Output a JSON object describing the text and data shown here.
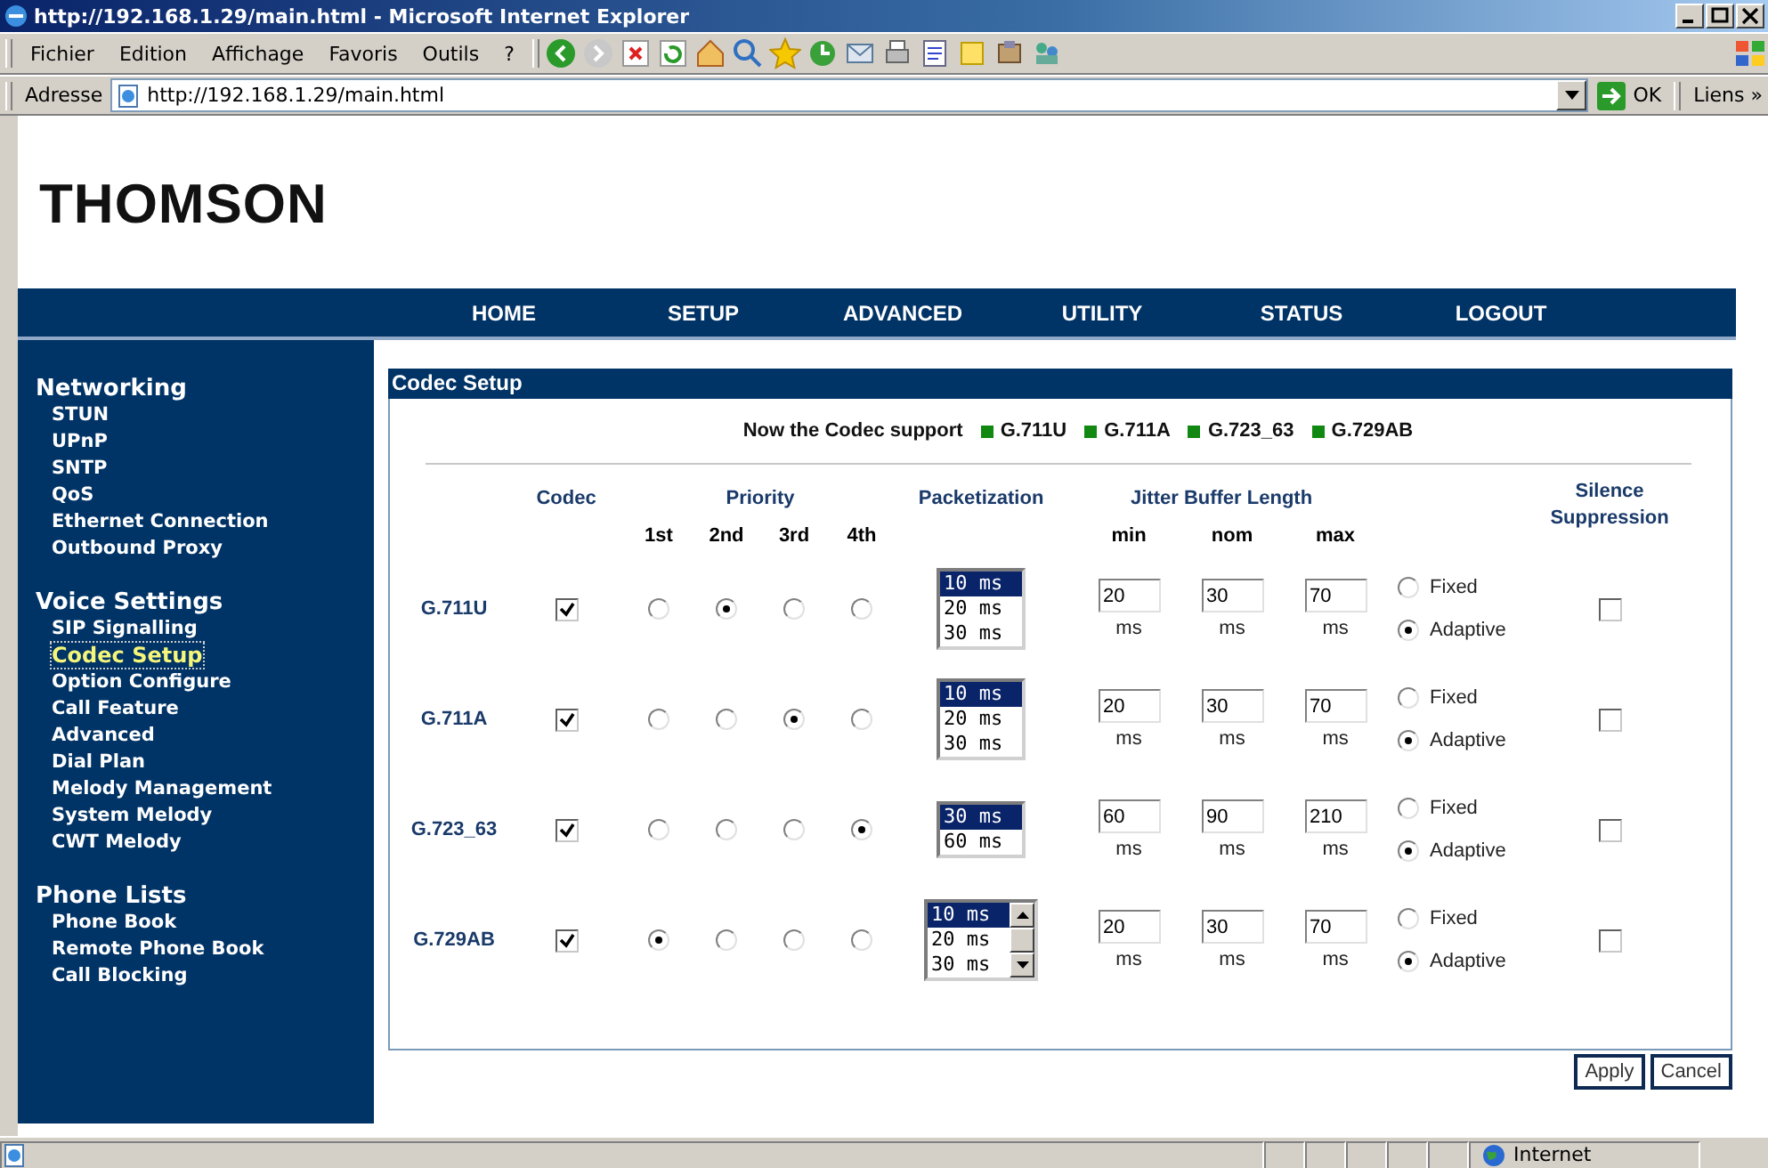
{
  "window": {
    "title": "http://192.168.1.29/main.html - Microsoft Internet Explorer"
  },
  "menu": [
    "Fichier",
    "Edition",
    "Affichage",
    "Favoris",
    "Outils",
    "?"
  ],
  "address_bar": {
    "label": "Adresse",
    "value": "http://192.168.1.29/main.html",
    "go": "OK",
    "links": "Liens",
    "more": "»"
  },
  "logo": "THOMSON",
  "nav": [
    "HOME",
    "SETUP",
    "ADVANCED",
    "UTILITY",
    "STATUS",
    "LOGOUT"
  ],
  "sidebar": [
    {
      "heading": "Networking",
      "items": [
        {
          "label": "STUN",
          "selected": false
        },
        {
          "label": "UPnP",
          "selected": false
        },
        {
          "label": "SNTP",
          "selected": false
        },
        {
          "label": "QoS",
          "selected": false
        },
        {
          "label": "Ethernet Connection",
          "selected": false
        },
        {
          "label": "Outbound Proxy",
          "selected": false
        }
      ]
    },
    {
      "heading": "Voice Settings",
      "items": [
        {
          "label": "SIP Signalling",
          "selected": false
        },
        {
          "label": "Codec Setup",
          "selected": true
        },
        {
          "label": "Option Configure",
          "selected": false
        },
        {
          "label": "Call Feature",
          "selected": false
        },
        {
          "label": "Advanced",
          "selected": false
        },
        {
          "label": "Dial Plan",
          "selected": false
        },
        {
          "label": "Melody Management",
          "selected": false
        },
        {
          "label": "System Melody",
          "selected": false
        },
        {
          "label": "CWT Melody",
          "selected": false
        }
      ]
    },
    {
      "heading": "Phone Lists",
      "items": [
        {
          "label": "Phone Book",
          "selected": false
        },
        {
          "label": "Remote Phone Book",
          "selected": false
        },
        {
          "label": "Call Blocking",
          "selected": false
        }
      ]
    }
  ],
  "panel": {
    "title": "Codec Setup",
    "support_label": "Now the Codec support",
    "supported": [
      {
        "label": "G.711U",
        "color": "#118811"
      },
      {
        "label": "G.711A",
        "color": "#118811"
      },
      {
        "label": "G.723_63",
        "color": "#118811"
      },
      {
        "label": "G.729AB",
        "color": "#118811"
      }
    ],
    "headers": {
      "codec": "Codec",
      "priority": "Priority",
      "priorities": [
        "1st",
        "2nd",
        "3rd",
        "4th"
      ],
      "packetization": "Packetization",
      "jitter": "Jitter Buffer Length",
      "jitter_cols": [
        "min",
        "nom",
        "max"
      ],
      "silence": "Silence Suppression"
    },
    "rows": [
      {
        "name": "G.711U",
        "enabled": true,
        "priority": [
          {
            "selected": false
          },
          {
            "selected": true
          },
          {
            "selected": false
          },
          {
            "selected": false
          }
        ],
        "packetization": {
          "scrollable": false,
          "options": [
            {
              "label": "10 ms",
              "selected": true
            },
            {
              "label": "20 ms",
              "selected": false
            },
            {
              "label": "30 ms",
              "selected": false
            }
          ]
        },
        "jitter": [
          {
            "value": "20",
            "unit": "ms"
          },
          {
            "value": "30",
            "unit": "ms"
          },
          {
            "value": "70",
            "unit": "ms"
          }
        ],
        "modes": [
          {
            "label": "Fixed",
            "selected": false
          },
          {
            "label": "Adaptive",
            "selected": true
          }
        ],
        "silence_suppression": false
      },
      {
        "name": "G.711A",
        "enabled": true,
        "priority": [
          {
            "selected": false
          },
          {
            "selected": false
          },
          {
            "selected": true
          },
          {
            "selected": false
          }
        ],
        "packetization": {
          "scrollable": false,
          "options": [
            {
              "label": "10 ms",
              "selected": true
            },
            {
              "label": "20 ms",
              "selected": false
            },
            {
              "label": "30 ms",
              "selected": false
            }
          ]
        },
        "jitter": [
          {
            "value": "20",
            "unit": "ms"
          },
          {
            "value": "30",
            "unit": "ms"
          },
          {
            "value": "70",
            "unit": "ms"
          }
        ],
        "modes": [
          {
            "label": "Fixed",
            "selected": false
          },
          {
            "label": "Adaptive",
            "selected": true
          }
        ],
        "silence_suppression": false
      },
      {
        "name": "G.723_63",
        "enabled": true,
        "priority": [
          {
            "selected": false
          },
          {
            "selected": false
          },
          {
            "selected": false
          },
          {
            "selected": true
          }
        ],
        "packetization": {
          "scrollable": false,
          "options": [
            {
              "label": "30 ms",
              "selected": true
            },
            {
              "label": "60 ms",
              "selected": false
            }
          ]
        },
        "jitter": [
          {
            "value": "60",
            "unit": "ms"
          },
          {
            "value": "90",
            "unit": "ms"
          },
          {
            "value": "210",
            "unit": "ms"
          }
        ],
        "modes": [
          {
            "label": "Fixed",
            "selected": false
          },
          {
            "label": "Adaptive",
            "selected": true
          }
        ],
        "silence_suppression": false
      },
      {
        "name": "G.729AB",
        "enabled": true,
        "priority": [
          {
            "selected": true
          },
          {
            "selected": false
          },
          {
            "selected": false
          },
          {
            "selected": false
          }
        ],
        "packetization": {
          "scrollable": true,
          "options": [
            {
              "label": "10 ms",
              "selected": true
            },
            {
              "label": "20 ms",
              "selected": false
            },
            {
              "label": "30 ms",
              "selected": false
            }
          ]
        },
        "jitter": [
          {
            "value": "20",
            "unit": "ms"
          },
          {
            "value": "30",
            "unit": "ms"
          },
          {
            "value": "70",
            "unit": "ms"
          }
        ],
        "modes": [
          {
            "label": "Fixed",
            "selected": false
          },
          {
            "label": "Adaptive",
            "selected": true
          }
        ],
        "silence_suppression": false
      }
    ],
    "buttons": [
      "Apply",
      "Cancel"
    ]
  },
  "status_bar": {
    "zone": "Internet"
  }
}
